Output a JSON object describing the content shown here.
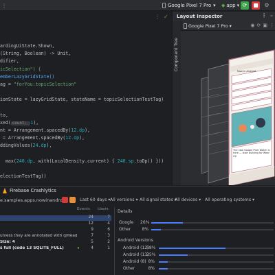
{
  "toolbar": {
    "device": "Google Pixel 7 Pro",
    "app": "app",
    "colors": {
      "run": "#3fa14a",
      "stop": "#d13b3b"
    }
  },
  "editor": {
    "code_lines": [
      {
        "parts": [
          {
            "t": "ardingUiState.Shown,",
            "c": "par"
          }
        ]
      },
      {
        "parts": [
          {
            "t": "(String, Boolean) -> Unit,",
            "c": "par"
          }
        ]
      },
      {
        "parts": [
          {
            "t": "difier,",
            "c": "par"
          }
        ]
      },
      {
        "parts": [
          {
            "t": "icSelection\") {",
            "c": "str"
          }
        ]
      },
      {
        "parts": [
          {
            "t": "emberLazyGridState()",
            "c": "fn"
          }
        ]
      },
      {
        "parts": [
          {
            "t": "ag = ",
            "c": "par"
          },
          {
            "t": "\"forYou:topicSelection\"",
            "c": "str"
          }
        ]
      },
      {
        "parts": [
          {
            "t": "",
            "c": "par"
          }
        ]
      },
      {
        "parts": [
          {
            "t": "ionState = lazyGridState, stateName = topicSelectionTestTag)",
            "c": "par"
          }
        ]
      },
      {
        "parts": [
          {
            "t": "",
            "c": "par"
          }
        ]
      },
      {
        "parts": [
          {
            "t": "to,",
            "c": "par"
          }
        ]
      },
      {
        "parts": [
          {
            "t": "xed(",
            "c": "par"
          },
          {
            "t": "count: ",
            "c": "hint"
          },
          {
            "t": "1",
            "c": "num"
          },
          {
            "t": "),",
            "c": "par"
          }
        ]
      },
      {
        "parts": [
          {
            "t": "nt = Arrangement.spacedBy(",
            "c": "par"
          },
          {
            "t": "12.dp",
            "c": "num"
          },
          {
            "t": "),",
            "c": "par"
          }
        ]
      },
      {
        "parts": [
          {
            "t": " = Arrangement.spacedBy(",
            "c": "par"
          },
          {
            "t": "12.dp",
            "c": "num"
          },
          {
            "t": "),",
            "c": "par"
          }
        ]
      },
      {
        "parts": [
          {
            "t": "ddingValues(",
            "c": "par"
          },
          {
            "t": "24.dp",
            "c": "num"
          },
          {
            "t": "),",
            "c": "par"
          }
        ]
      },
      {
        "parts": [
          {
            "t": "",
            "c": "par"
          }
        ]
      },
      {
        "parts": [
          {
            "t": "  max(",
            "c": "par"
          },
          {
            "t": "240.dp",
            "c": "num"
          },
          {
            "t": ", with(LocalDensity.current) { ",
            "c": "par"
          },
          {
            "t": "240.sp",
            "c": "num"
          },
          {
            "t": ".toDp() }))",
            "c": "par"
          }
        ]
      },
      {
        "parts": [
          {
            "t": "",
            "c": "par"
          }
        ]
      },
      {
        "parts": [
          {
            "t": "electionTestTag))",
            "c": "par"
          }
        ]
      }
    ]
  },
  "inspector": {
    "title": "Layout Inspector",
    "device": "Google Pixel 7 Pro",
    "component_tree": "Component Tree",
    "phone_texts": {
      "heading": "Now in Android",
      "card_title": "The new Google Pixel Watch is here — start building for Wear OS"
    }
  },
  "firebase": {
    "title": "Firebase Crashlytics",
    "app_id": "e.samples.apps.nowinandroid",
    "filters": [
      "Last 60 days",
      "All versions",
      "All signal states",
      "All devices",
      "All operating systems"
    ],
    "columns": {
      "events": "Events",
      "users": "Users"
    },
    "issues": [
      {
        "title": "",
        "events": "24",
        "users": "7",
        "selected": true
      },
      {
        "title": "",
        "events": "12",
        "users": "4"
      },
      {
        "title": "",
        "events": "9",
        "users": "6"
      },
      {
        "title": "unless they are annotated with @Readable.",
        "events": "7",
        "users": "3"
      },
      {
        "title": "Size: 4",
        "events": "5",
        "users": "2"
      },
      {
        "title": "s full (code 13 SQLITE_FULL)",
        "events": "4",
        "users": "1",
        "flag": true
      }
    ],
    "details": {
      "title": "Details",
      "device_stats": [
        {
          "label": "Google",
          "pct": 26
        },
        {
          "label": "Other",
          "pct": 8
        }
      ],
      "android_label": "Android Versions",
      "android_stats": [
        {
          "label": "Android (12)",
          "pct": 58
        },
        {
          "label": "Android (13)",
          "pct": 25
        },
        {
          "label": "Android (8)",
          "pct": 8
        },
        {
          "label": "Other",
          "pct": 8
        }
      ],
      "bar_color": "#4a80ff"
    }
  }
}
